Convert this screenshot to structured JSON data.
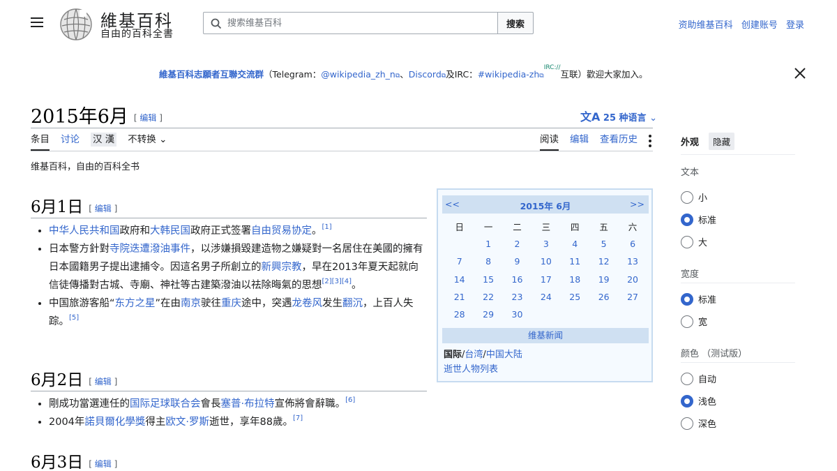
{
  "header": {
    "site_title": "維基百科",
    "site_subtitle": "自由的百科全書",
    "search_placeholder": "搜索维基百科",
    "search_button": "搜索",
    "links": [
      "资助维基百科",
      "创建账号",
      "登录"
    ]
  },
  "banner": {
    "group": "維基百科志願者互聯交流群",
    "p1": "（Telegram：",
    "telegram": "@wikipedia_zh_n",
    "p2": "、",
    "discord": "Discord",
    "p3": "及IRC：",
    "irc": "#wikipedia-zh",
    "irc_sup": "IRC://",
    "p4": "互联）歡迎大家加入。"
  },
  "page": {
    "title": "2015年6月",
    "edit_label": "编辑",
    "languages": "25 种语言",
    "tagline": "维基百科，自由的百科全书"
  },
  "tabs_left": [
    "条目",
    "讨论",
    "汉 漢",
    "不转换"
  ],
  "tabs_right": [
    "阅读",
    "编辑",
    "查看历史"
  ],
  "sections": [
    {
      "heading": "6月1日",
      "items": [
        [
          "中华人民共和国",
          "政府和",
          "大韩民国",
          "政府正式签署",
          "自由贸易协定",
          "。",
          "[1]"
        ],
        [
          "日本警方針對",
          "寺院迭遭潑油事件",
          "，以涉嫌損毀建造物之嫌疑對一名居住在美國的擁有日本國籍男子提出逮捕令。因這名男子所創立的",
          "新興宗教",
          "，早在2013年夏天起就向信徒傳播對古城、寺廟、神社等古建築潑油以祛除晦氣的思想",
          "[2][3][4]",
          "。"
        ],
        [
          "中国旅游客船“",
          "东方之星",
          "”在由",
          "南京",
          "驶往",
          "重庆",
          "途中，突遇",
          "龙卷风",
          "发生",
          "翻沉",
          "，上百人失踪。",
          "[5]"
        ]
      ]
    },
    {
      "heading": "6月2日",
      "items": [
        [
          "剛成功當選連任的",
          "国际足球联合会",
          "會長",
          "塞普·布拉特",
          "宣佈將會辭職。",
          "[6]"
        ],
        [
          "2004年",
          "諾貝爾化學獎",
          "得主",
          "欧文·罗斯",
          "逝世，享年88歲。",
          "[7]"
        ]
      ]
    },
    {
      "heading": "6月3日",
      "items": []
    }
  ],
  "calendar": {
    "prev": "<<",
    "title": "2015年 6月",
    "next": ">>",
    "weekdays": [
      "日",
      "一",
      "二",
      "三",
      "四",
      "五",
      "六"
    ],
    "weeks": [
      [
        "",
        "1",
        "2",
        "3",
        "4",
        "5",
        "6"
      ],
      [
        "7",
        "8",
        "9",
        "10",
        "11",
        "12",
        "13"
      ],
      [
        "14",
        "15",
        "16",
        "17",
        "18",
        "19",
        "20"
      ],
      [
        "21",
        "22",
        "23",
        "24",
        "25",
        "26",
        "27"
      ],
      [
        "28",
        "29",
        "30",
        "",
        "",
        "",
        ""
      ]
    ],
    "news_title": "维基新闻",
    "intl": "国际",
    "taiwan": "台湾",
    "mainland": "中国大陆",
    "obits": "逝世人物列表"
  },
  "appearance": {
    "title": "外观",
    "hide": "隐藏",
    "text_label": "文本",
    "text_options": [
      "小",
      "标准",
      "大"
    ],
    "text_selected": "标准",
    "width_label": "宽度",
    "width_options": [
      "标准",
      "宽"
    ],
    "width_selected": "标准",
    "color_label": "颜色 （测试版）",
    "color_options": [
      "自动",
      "浅色",
      "深色"
    ],
    "color_selected": "浅色"
  }
}
